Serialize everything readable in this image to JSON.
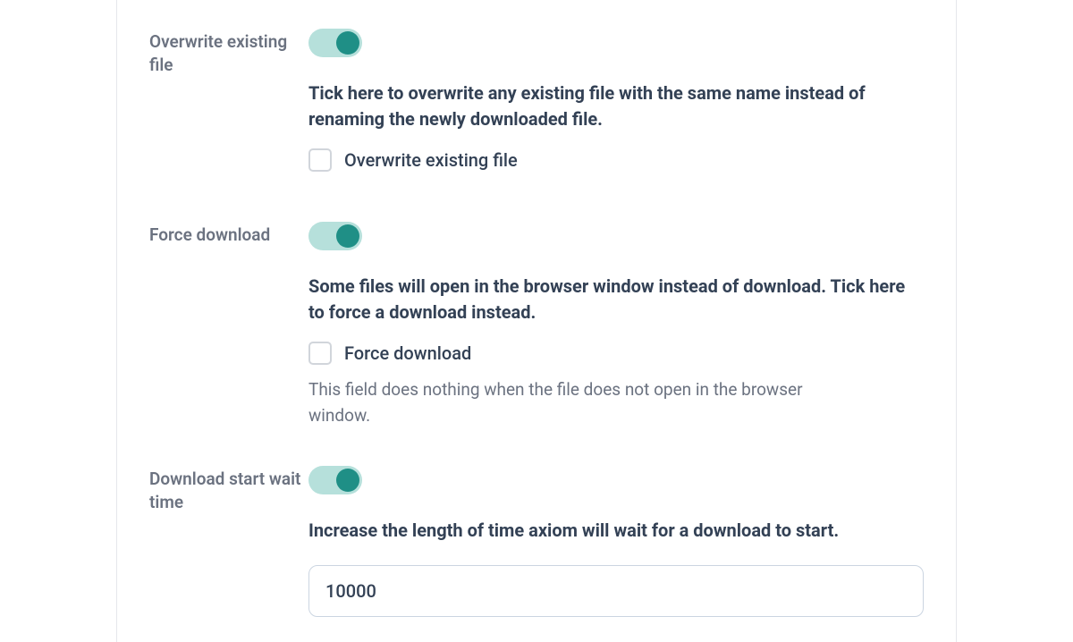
{
  "settings": {
    "overwrite": {
      "title": "Overwrite existing file",
      "toggle_on": true,
      "description": "Tick here to overwrite any existing file with the same name instead of renaming the newly downloaded file.",
      "checkbox_label": "Overwrite existing file",
      "checkbox_checked": false
    },
    "force_download": {
      "title": "Force download",
      "toggle_on": true,
      "description": "Some files will open in the browser window instead of download. Tick here to force a download instead.",
      "checkbox_label": "Force download",
      "checkbox_checked": false,
      "hint": "This field does nothing when the file does not open in the browser window."
    },
    "wait_time": {
      "title": "Download start wait time",
      "toggle_on": true,
      "description": "Increase the length of time axiom will wait for a download to start.",
      "input_value": "10000"
    }
  }
}
